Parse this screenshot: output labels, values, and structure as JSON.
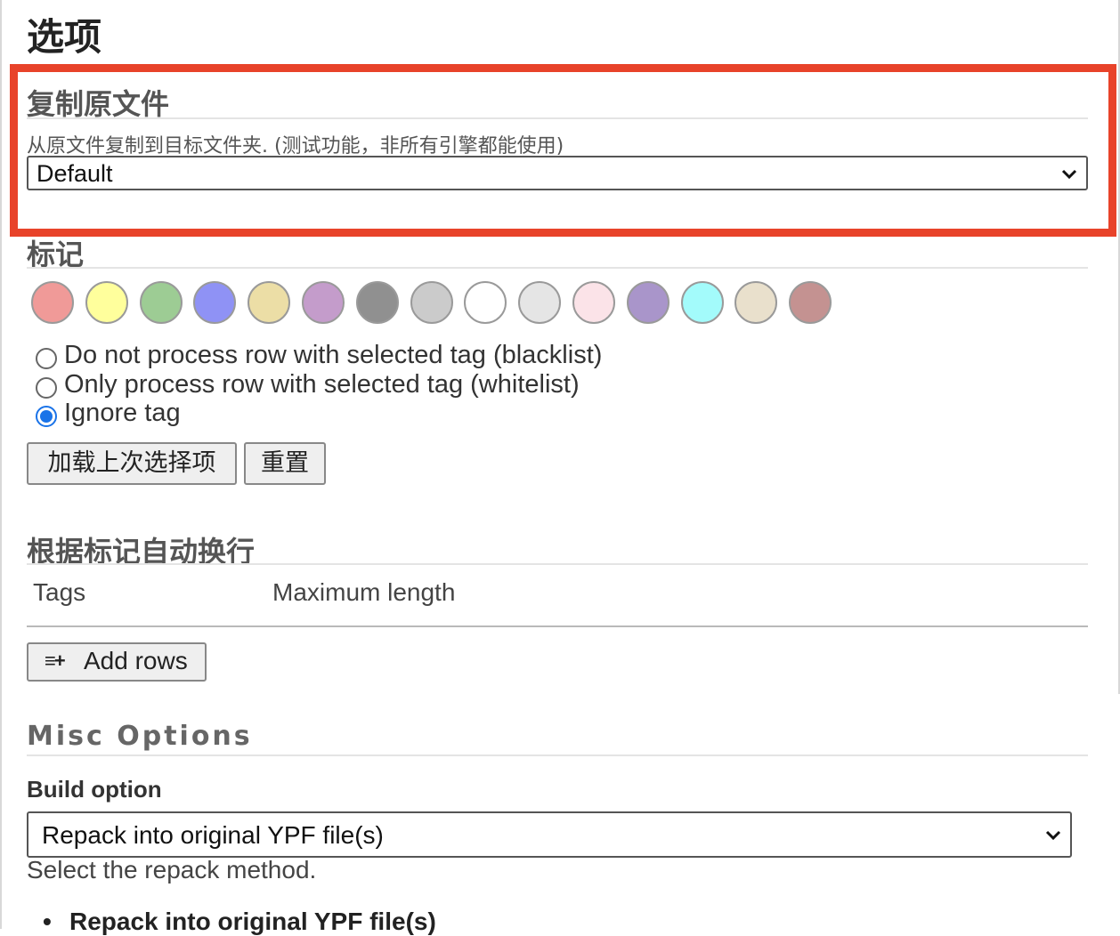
{
  "page": {
    "title": "选项"
  },
  "copy_original": {
    "title": "复制原文件",
    "description": "从原文件复制到目标文件夹. (测试功能，非所有引擎都能使用)",
    "select_value": "Default",
    "highlight_color": "#e8432a"
  },
  "tags": {
    "title": "标记",
    "swatches": [
      "#f09a98",
      "#ffff9c",
      "#9dcc94",
      "#8f92f5",
      "#ecdea6",
      "#c49ccb",
      "#909090",
      "#cbcbcb",
      "#ffffff",
      "#e5e5e5",
      "#fbe3e8",
      "#a995ca",
      "#a3fbfb",
      "#e9e0cc",
      "#c49291"
    ],
    "radios": [
      {
        "label": "Do not process row with selected tag (blacklist)",
        "checked": false
      },
      {
        "label": "Only process row with selected tag (whitelist)",
        "checked": false
      },
      {
        "label": "Ignore tag",
        "checked": true
      }
    ],
    "load_button": "加载上次选择项",
    "reset_button": "重置"
  },
  "wrap": {
    "title": "根据标记自动换行",
    "columns": [
      "Tags",
      "Maximum length"
    ],
    "add_icon": "≡+",
    "add_label": "Add rows"
  },
  "misc": {
    "title": "Misc Options",
    "build_label": "Build option",
    "build_value": "Repack into original YPF file(s)",
    "help": "Select the repack method.",
    "bullet": "Repack into original YPF file(s)"
  }
}
